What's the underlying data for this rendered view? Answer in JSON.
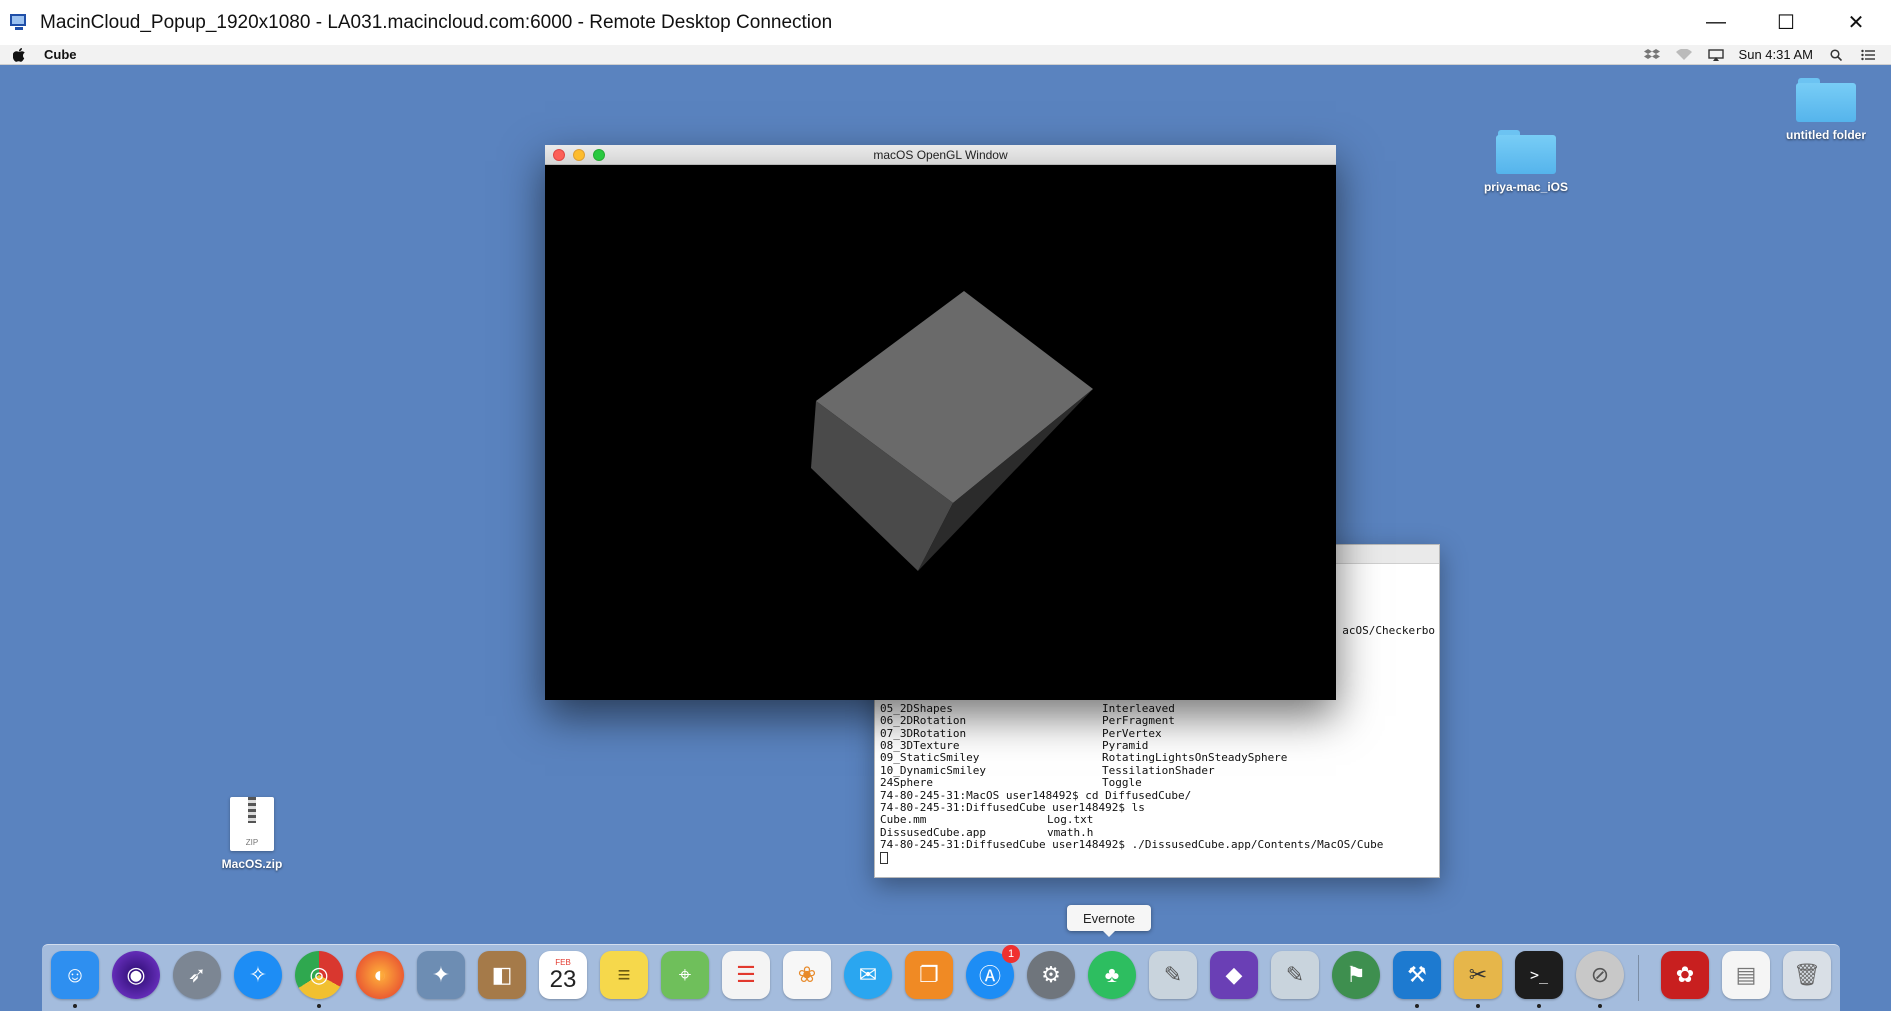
{
  "rdp_window": {
    "title": "MacinCloud_Popup_1920x1080 - LA031.macincloud.com:6000 - Remote Desktop Connection",
    "controls": {
      "minimize": "—",
      "maximize": "☐",
      "close": "✕"
    }
  },
  "menubar": {
    "app_name": "Cube",
    "clock": "Sun 4:31 AM",
    "icons": [
      "dropbox-icon",
      "wifi-icon",
      "airplay-icon",
      "search-icon",
      "list-icon"
    ]
  },
  "desktop": {
    "items": [
      {
        "label": "untitled folder",
        "kind": "folder"
      },
      {
        "label": "priya-mac_iOS",
        "kind": "folder"
      },
      {
        "label": "MacOS.zip",
        "kind": "zip",
        "file_tag": "ZIP"
      }
    ]
  },
  "gl_window": {
    "title": "macOS OpenGL Window"
  },
  "terminal": {
    "partial_line": "acOS/Checkerbo",
    "listing": [
      [
        "05_2DShapes",
        "Interleaved"
      ],
      [
        "06_2DRotation",
        "PerFragment"
      ],
      [
        "07_3DRotation",
        "PerVertex"
      ],
      [
        "08_3DTexture",
        "Pyramid"
      ],
      [
        "09_StaticSmiley",
        "RotatingLightsOnSteadySphere"
      ],
      [
        "10_DynamicSmiley",
        "TessilationShader"
      ],
      [
        "24Sphere",
        "Toggle"
      ]
    ],
    "cmd1": "74-80-245-31:MacOS user148492$ cd DiffusedCube/",
    "cmd2": "74-80-245-31:DiffusedCube user148492$ ls",
    "files": [
      [
        "Cube.mm",
        "Log.txt"
      ],
      [
        "DissusedCube.app",
        "vmath.h"
      ]
    ],
    "cmd3": "74-80-245-31:DiffusedCube user148492$ ./DissusedCube.app/Contents/MacOS/Cube"
  },
  "dock": {
    "tooltip": "Evernote",
    "calendar_month": "FEB",
    "calendar_day": "23",
    "app_store_badge": "1",
    "items": [
      {
        "name": "finder",
        "glyph": "☺",
        "color": "#2e8ff0"
      },
      {
        "name": "siri",
        "glyph": "◉",
        "color": "#5b3bbf"
      },
      {
        "name": "launchpad",
        "glyph": "➶",
        "color": "#7c8693"
      },
      {
        "name": "safari",
        "glyph": "✧",
        "color": "#1d8df5"
      },
      {
        "name": "chrome",
        "glyph": "◎",
        "color": "#d9372f"
      },
      {
        "name": "firefox",
        "glyph": "◐",
        "color": "#f0702d"
      },
      {
        "name": "preview",
        "glyph": "✦",
        "color": "#6d8db3"
      },
      {
        "name": "contacts",
        "glyph": "◧",
        "color": "#a57a49"
      },
      {
        "name": "calendar",
        "glyph": "",
        "color": "#ffffff"
      },
      {
        "name": "notes",
        "glyph": "≡",
        "color": "#f6d84b"
      },
      {
        "name": "maps",
        "glyph": "⌖",
        "color": "#6fbf5b"
      },
      {
        "name": "reminders",
        "glyph": "☰",
        "color": "#f4f4f4"
      },
      {
        "name": "photos",
        "glyph": "❀",
        "color": "#f7f7f7"
      },
      {
        "name": "messages",
        "glyph": "✉",
        "color": "#2aa6f0"
      },
      {
        "name": "books",
        "glyph": "❐",
        "color": "#f08a24"
      },
      {
        "name": "app-store",
        "glyph": "Ⓐ",
        "color": "#1d8df5"
      },
      {
        "name": "system-preferences",
        "glyph": "⚙",
        "color": "#6f757c"
      },
      {
        "name": "evernote",
        "glyph": "♣",
        "color": "#2dbe60"
      },
      {
        "name": "vim-editor",
        "glyph": "✎",
        "color": "#c9d4dd"
      },
      {
        "name": "visual-studio",
        "glyph": "◆",
        "color": "#6a3fb5"
      },
      {
        "name": "text-editor",
        "glyph": "✎",
        "color": "#c9d4dd"
      },
      {
        "name": "android-studio",
        "glyph": "⚑",
        "color": "#3e8f4f"
      },
      {
        "name": "xcode",
        "glyph": "⚒",
        "color": "#1d7ad0"
      },
      {
        "name": "archive-utility",
        "glyph": "✂",
        "color": "#e6b64a"
      },
      {
        "name": "terminal",
        "glyph": ">_",
        "color": "#1d1d1d"
      },
      {
        "name": "no-entry-app",
        "glyph": "⊘",
        "color": "#c8c8c8"
      },
      {
        "name": "acrobat",
        "glyph": "✿",
        "color": "#c81f1f"
      },
      {
        "name": "zip-file",
        "glyph": "▤",
        "color": "#f5f5f5"
      },
      {
        "name": "trash",
        "glyph": "🗑",
        "color": "#d9dfe6"
      }
    ]
  }
}
